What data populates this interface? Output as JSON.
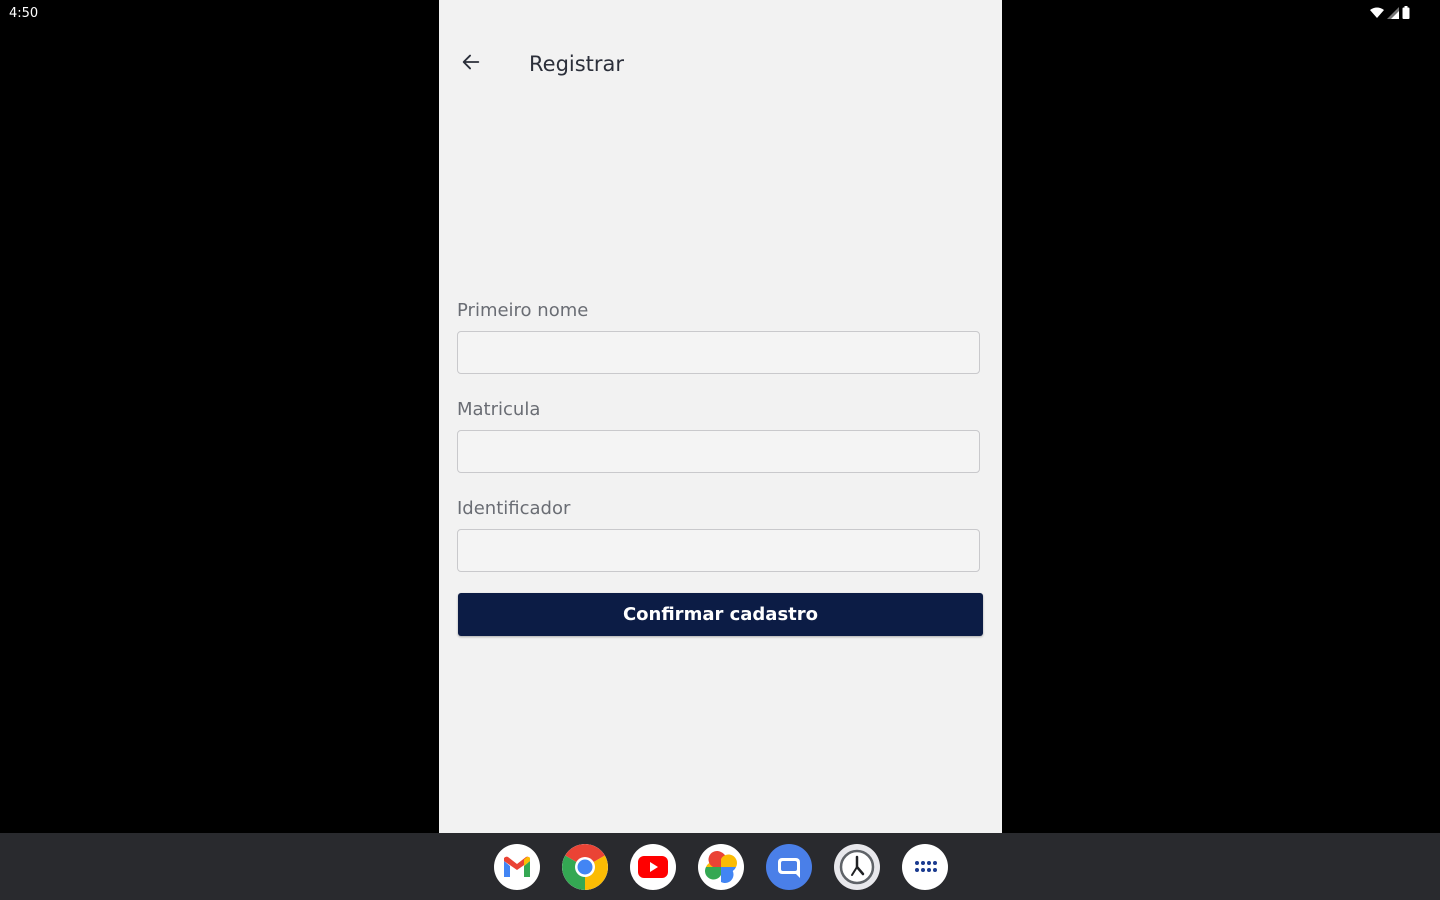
{
  "status_bar": {
    "time": "4:50",
    "icons": [
      "wifi-icon",
      "signal-icon",
      "battery-icon"
    ]
  },
  "app": {
    "title": "Registrar",
    "back_icon": "arrow-left-icon",
    "background": "#f2f2f2",
    "fields": [
      {
        "label": "Primeiro nome",
        "value": "",
        "placeholder": ""
      },
      {
        "label": "Matricula",
        "value": "",
        "placeholder": ""
      },
      {
        "label": "Identificador",
        "value": "",
        "placeholder": ""
      }
    ],
    "confirm_label": "Confirmar cadastro",
    "accent": "#0c1c45"
  },
  "taskbar": {
    "apps": [
      "gmail-icon",
      "chrome-icon",
      "youtube-icon",
      "photos-icon",
      "messages-icon",
      "clock-icon",
      "app-drawer-icon"
    ]
  }
}
